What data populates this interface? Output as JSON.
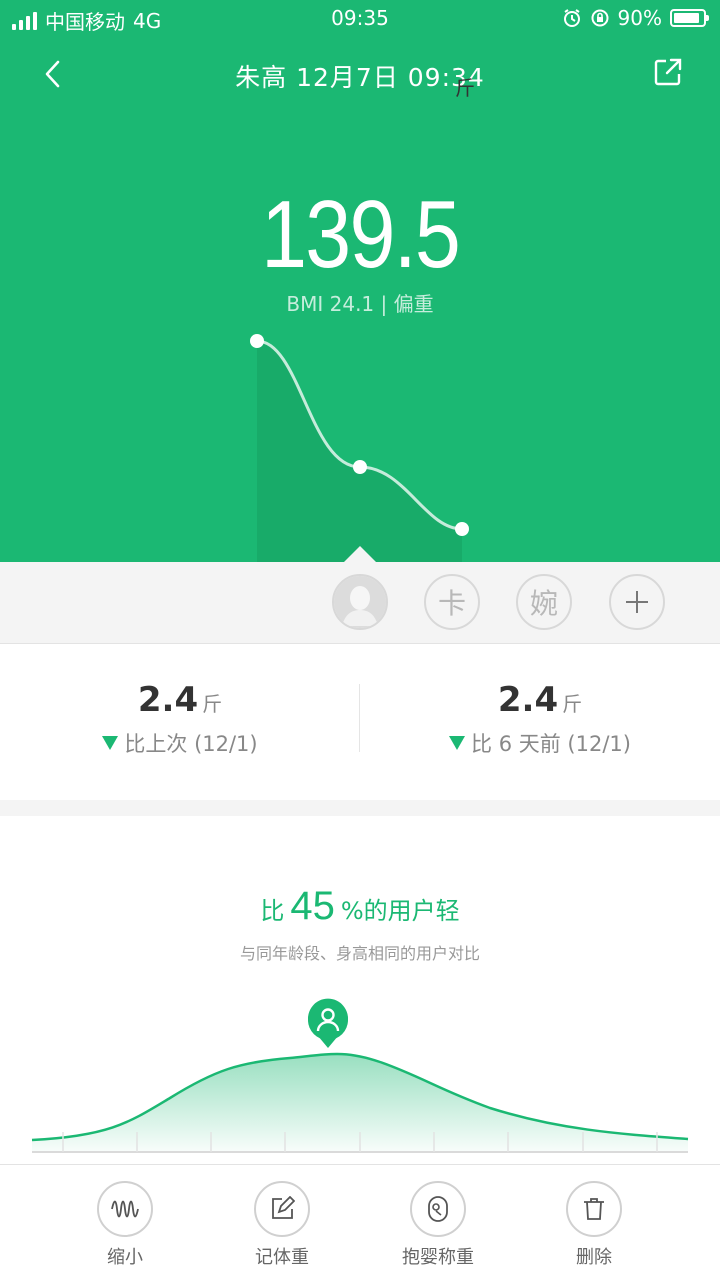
{
  "status_bar": {
    "carrier": "中国移动",
    "network": "4G",
    "time": "09:35",
    "battery": "90%",
    "battery_level": 0.9,
    "icons": [
      "signal-icon",
      "alarm-icon",
      "rotation-lock-icon",
      "battery-icon"
    ]
  },
  "header": {
    "title": "朱高 12月7日 09:34",
    "back_icon": "back-arrow-icon",
    "share_icon": "share-icon"
  },
  "measurement": {
    "weight": "139.5",
    "unit": "斤",
    "bmi_text": "BMI 24.1 | 偏重"
  },
  "trend_chart": {
    "type": "line",
    "points": 3,
    "series_note": ""
  },
  "profiles": [
    {
      "kind": "avatar",
      "label": ""
    },
    {
      "kind": "text",
      "label": "卡"
    },
    {
      "kind": "text",
      "label": "婉"
    },
    {
      "kind": "add",
      "label": "+"
    }
  ],
  "stats": [
    {
      "value": "2.4",
      "unit": "斤",
      "label": "比上次 (12/1)"
    },
    {
      "value": "2.4",
      "unit": "斤",
      "label": "比 6 天前 (12/1)"
    }
  ],
  "comparison": {
    "prefix": "比",
    "percent": "45",
    "suffix": "%的用户轻",
    "subtitle": "与同年龄段、身高相同的用户对比",
    "user_marker_icon": "user-location-icon"
  },
  "toolbar": [
    {
      "label": "缩小",
      "icon": "wave-icon"
    },
    {
      "label": "记体重",
      "icon": "edit-icon"
    },
    {
      "label": "抱婴称重",
      "icon": "baby-scale-icon"
    },
    {
      "label": "删除",
      "icon": "trash-icon"
    }
  ],
  "colors": {
    "brand_green": "#1bb873",
    "dark_green_fill": "#18a867",
    "background_gray": "#f4f4f4"
  }
}
